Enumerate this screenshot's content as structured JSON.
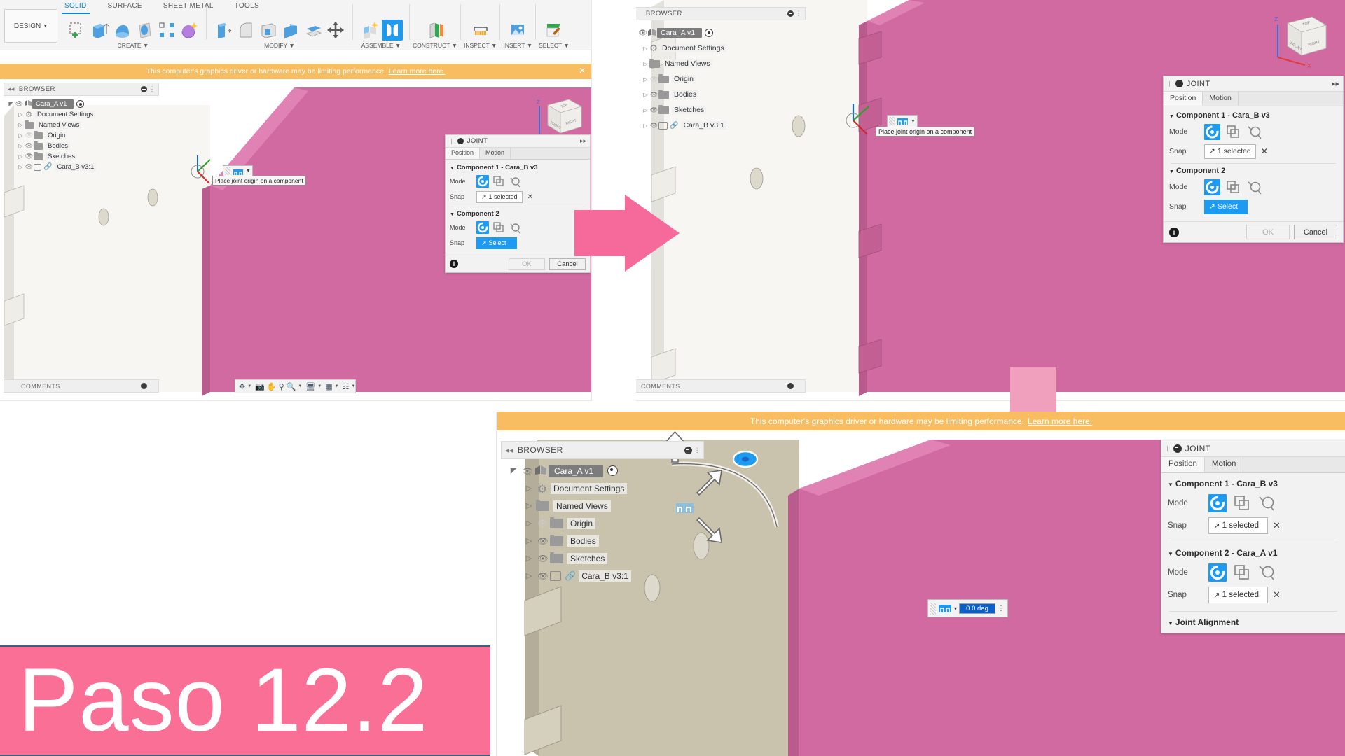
{
  "app": {
    "name": "Autodesk Fusion 360",
    "design_button": "DESIGN",
    "ribbon_tabs": [
      {
        "label": "SOLID",
        "active": true
      },
      {
        "label": "SURFACE",
        "active": false
      },
      {
        "label": "SHEET METAL",
        "active": false
      },
      {
        "label": "TOOLS",
        "active": false
      }
    ],
    "ribbon_groups": [
      {
        "label": "CREATE",
        "icons": [
          "create-sketch-icon",
          "extrude-icon",
          "revolve-icon",
          "sweep-icon",
          "pattern-icon",
          "sphere-icon"
        ]
      },
      {
        "label": "MODIFY",
        "icons": [
          "press-pull-icon",
          "fillet-icon",
          "shell-icon",
          "combine-icon",
          "offset-face-icon",
          "move-copy-icon"
        ]
      },
      {
        "label": "ASSEMBLE",
        "icons": [
          "new-component-icon",
          "joint-icon"
        ],
        "active_icon_index": 1
      },
      {
        "label": "CONSTRUCT",
        "icons": [
          "offset-plane-icon"
        ]
      },
      {
        "label": "INSPECT",
        "icons": [
          "measure-icon"
        ]
      },
      {
        "label": "INSERT",
        "icons": [
          "insert-mcmaster-icon"
        ]
      },
      {
        "label": "SELECT",
        "icons": [
          "select-icon"
        ]
      }
    ]
  },
  "warning": {
    "text": "This computer's graphics driver or hardware may be limiting performance.",
    "link": "Learn more here.",
    "close": "✕",
    "bg_color": "#f8bd61"
  },
  "browser": {
    "title": "BROWSER",
    "collapse_icon": "◂◂",
    "items": [
      {
        "label": "Cara_A v1",
        "type": "root",
        "visible": true
      },
      {
        "label": "Document Settings",
        "type": "settings",
        "visible": null
      },
      {
        "label": "Named Views",
        "type": "folder",
        "visible": null
      },
      {
        "label": "Origin",
        "type": "folder",
        "visible": false
      },
      {
        "label": "Bodies",
        "type": "folder",
        "visible": true
      },
      {
        "label": "Sketches",
        "type": "folder",
        "visible": true
      },
      {
        "label": "Cara_B v3:1",
        "type": "component",
        "visible": true
      }
    ]
  },
  "comments": {
    "title": "COMMENTS"
  },
  "tooltip": {
    "text": "Place joint origin on a component"
  },
  "navbar": {
    "items": [
      "orbit-icon",
      "pan-icon",
      "zoom-icon",
      "zoom-window-icon",
      "display-settings-icon",
      "grid-snap-icon",
      "viewports-icon"
    ]
  },
  "viewcube": {
    "top": "TOP",
    "front": "FRONT",
    "right": "RIGHT",
    "axis_z": "Z",
    "axis_x": "X"
  },
  "joint_dialogs": {
    "step1": {
      "title": "JOINT",
      "pin_icon": "▸▸",
      "tabs": [
        {
          "label": "Position",
          "active": true
        },
        {
          "label": "Motion",
          "active": false
        }
      ],
      "sections": [
        {
          "header": "Component 1 - Cara_B v3",
          "mode_label": "Mode",
          "snap_label": "Snap",
          "modes": [
            "joint-origin-mode-icon",
            "between-two-faces-mode-icon",
            "point-to-position-mode-icon"
          ],
          "active_mode": 0,
          "snap_value": "1 selected",
          "snap_highlighted": false,
          "clear": "✕"
        },
        {
          "header": "Component 2",
          "mode_label": "Mode",
          "snap_label": "Snap",
          "modes": [
            "joint-origin-mode-icon",
            "between-two-faces-mode-icon",
            "point-to-position-mode-icon"
          ],
          "active_mode": 0,
          "snap_value": "Select",
          "snap_highlighted": true,
          "clear": ""
        }
      ],
      "ok": "OK",
      "cancel": "Cancel",
      "info": "i"
    },
    "step3": {
      "title": "JOINT",
      "tabs": [
        {
          "label": "Position",
          "active": true
        },
        {
          "label": "Motion",
          "active": false
        }
      ],
      "sections": [
        {
          "header": "Component 1 - Cara_B v3",
          "mode_label": "Mode",
          "snap_label": "Snap",
          "modes": [
            "joint-origin-mode-icon",
            "between-two-faces-mode-icon",
            "point-to-position-mode-icon"
          ],
          "active_mode": 0,
          "snap_value": "1 selected",
          "snap_highlighted": false,
          "clear": "✕"
        },
        {
          "header": "Component 2 - Cara_A v1",
          "mode_label": "Mode",
          "snap_label": "Snap",
          "modes": [
            "joint-origin-mode-icon",
            "between-two-faces-mode-icon",
            "point-to-position-mode-icon"
          ],
          "active_mode": 0,
          "snap_value": "1 selected",
          "snap_highlighted": false,
          "clear": "✕"
        }
      ],
      "alignment_header": "Joint Alignment"
    }
  },
  "angle_field": {
    "value": "0.0 deg",
    "dropdown": "▾",
    "overflow": "⋮"
  },
  "caption": {
    "text": "Paso 12.2",
    "bg_color": "#fa6f96",
    "text_color": "#ffffff"
  },
  "flow_arrows": {
    "right_arrow_color": "#f56a9b",
    "down_arrow_color": "#f0a0bd"
  },
  "model_colors": {
    "pink_face": "#d06aa0",
    "pink_edge": "#e083b4",
    "beige_face": "#c9c3ae",
    "white_face": "#f7f6f3"
  }
}
